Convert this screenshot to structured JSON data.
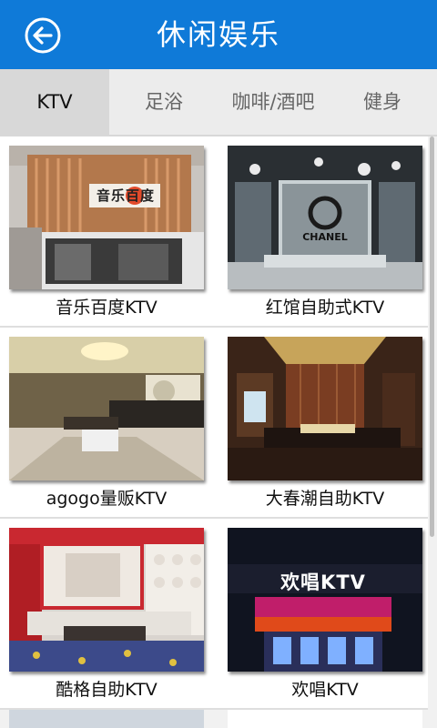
{
  "header": {
    "title": "休闲娱乐",
    "back_icon": "back-arrow-icon"
  },
  "tabs": [
    {
      "label": "KTV",
      "active": true
    },
    {
      "label": "足浴",
      "active": false
    },
    {
      "label": "咖啡/酒吧",
      "active": false
    },
    {
      "label": "健身",
      "active": false
    }
  ],
  "venues": [
    {
      "name": "音乐百度KTV",
      "sign_text": "音乐百度"
    },
    {
      "name": "红馆自助式KTV",
      "sign_text": "CHANEL"
    },
    {
      "name": "agogo量贩KTV"
    },
    {
      "name": "大春潮自助KTV"
    },
    {
      "name": "酷格自助KTV"
    },
    {
      "name": "欢唱KTV",
      "sign_text": "欢唱KTV"
    }
  ],
  "colors": {
    "header_bg": "#0f7ad8",
    "tab_active_bg": "#d8d8d8"
  }
}
